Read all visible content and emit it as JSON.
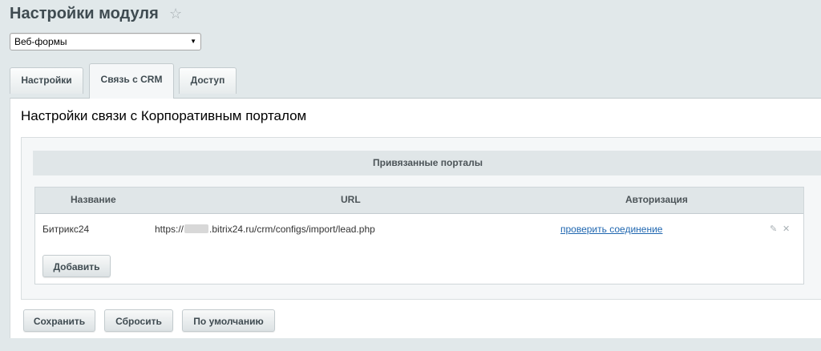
{
  "header": {
    "title": "Настройки модуля",
    "star_icon": "star-icon"
  },
  "module_select": {
    "value": "Веб-формы"
  },
  "tabs": [
    {
      "label": "Настройки",
      "active": false
    },
    {
      "label": "Связь с CRM",
      "active": true
    },
    {
      "label": "Доступ",
      "active": false
    }
  ],
  "panel": {
    "title": "Настройки связи с Корпоративным порталом",
    "table_title": "Привязанные порталы",
    "columns": [
      "Название",
      "URL",
      "Авторизация"
    ],
    "rows": [
      {
        "name": "Битрикс24",
        "url_prefix": "https://",
        "url_suffix": ".bitrix24.ru/crm/configs/import/lead.php",
        "auth_link": "проверить соединение"
      }
    ],
    "add_button": "Добавить"
  },
  "footer_buttons": {
    "save": "Сохранить",
    "reset": "Сбросить",
    "default": "По умолчанию"
  },
  "colors": {
    "background": "#e1e8ea",
    "link": "#2067b0",
    "header_bar": "#e0e6e8"
  }
}
